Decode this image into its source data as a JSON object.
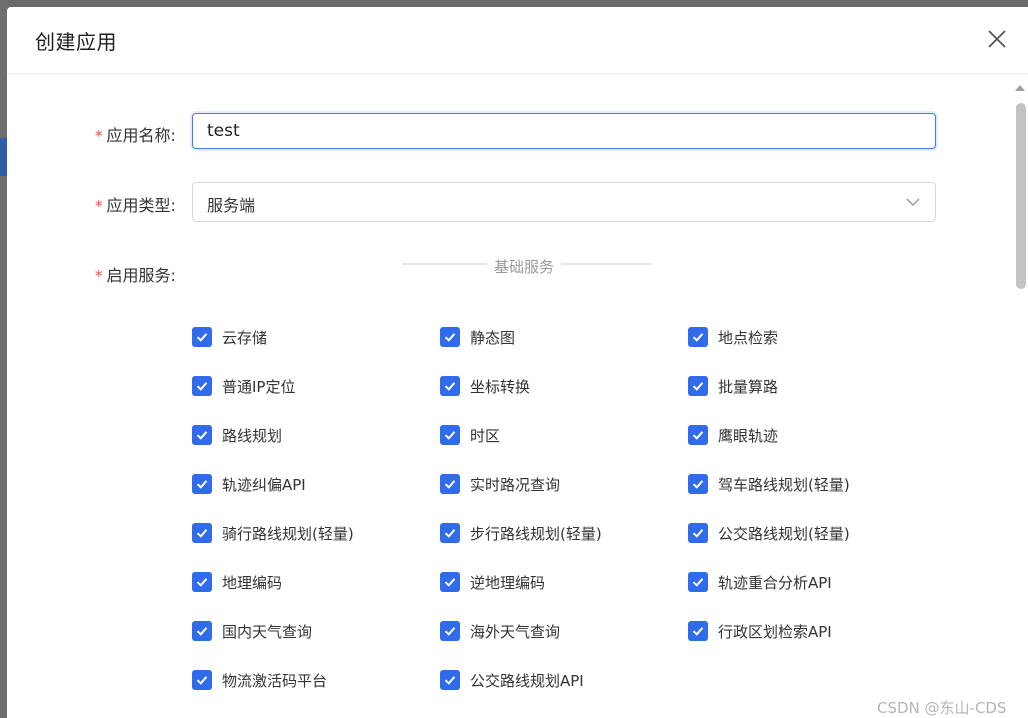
{
  "dialog": {
    "title": "创建应用"
  },
  "form": {
    "name": {
      "label": "应用名称:",
      "value": "test"
    },
    "type": {
      "label": "应用类型:",
      "value": "服务端"
    },
    "services": {
      "label": "启用服务:",
      "group_title": "基础服务",
      "items": [
        {
          "label": "云存储",
          "checked": true
        },
        {
          "label": "静态图",
          "checked": true
        },
        {
          "label": "地点检索",
          "checked": true
        },
        {
          "label": "普通IP定位",
          "checked": true
        },
        {
          "label": "坐标转换",
          "checked": true
        },
        {
          "label": "批量算路",
          "checked": true
        },
        {
          "label": "路线规划",
          "checked": true
        },
        {
          "label": "时区",
          "checked": true
        },
        {
          "label": "鹰眼轨迹",
          "checked": true
        },
        {
          "label": "轨迹纠偏API",
          "checked": true
        },
        {
          "label": "实时路况查询",
          "checked": true
        },
        {
          "label": "驾车路线规划(轻量)",
          "checked": true
        },
        {
          "label": "骑行路线规划(轻量)",
          "checked": true
        },
        {
          "label": "步行路线规划(轻量)",
          "checked": true
        },
        {
          "label": "公交路线规划(轻量)",
          "checked": true
        },
        {
          "label": "地理编码",
          "checked": true
        },
        {
          "label": "逆地理编码",
          "checked": true
        },
        {
          "label": "轨迹重合分析API",
          "checked": true
        },
        {
          "label": "国内天气查询",
          "checked": true
        },
        {
          "label": "海外天气查询",
          "checked": true
        },
        {
          "label": "行政区划检索API",
          "checked": true
        },
        {
          "label": "物流激活码平台",
          "checked": true
        },
        {
          "label": "公交路线规划API",
          "checked": true
        }
      ]
    }
  },
  "watermark": "CSDN @东山-CDS",
  "colors": {
    "accent": "#2f6bea",
    "required": "#f04a4a"
  },
  "icons": {
    "close": "close-icon",
    "dropdown": "chevron-down-icon",
    "check": "check-icon"
  }
}
